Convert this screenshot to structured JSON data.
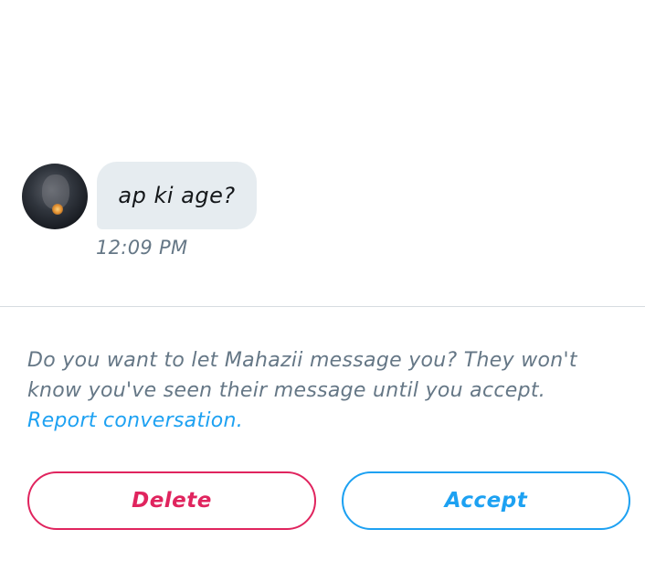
{
  "conversation": {
    "messages": [
      {
        "text": "ap ki age?",
        "time": "12:09 PM"
      }
    ]
  },
  "request": {
    "prompt_text": "Do you want to let Mahazii message you? They won't know you've seen their message until you accept.",
    "report_link": "Report conversation."
  },
  "actions": {
    "delete_label": "Delete",
    "accept_label": "Accept"
  },
  "colors": {
    "accent": "#1da1f2",
    "danger": "#e0245e",
    "bubble": "#e6ecf0",
    "muted_text": "#657786"
  }
}
